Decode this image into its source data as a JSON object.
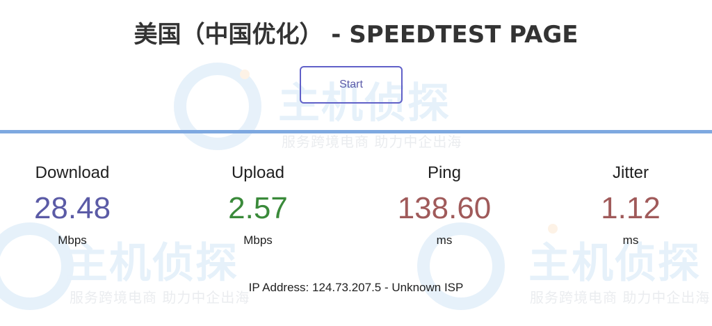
{
  "header": {
    "title": "美国（中国优化） - SPEEDTEST PAGE"
  },
  "controls": {
    "start_label": "Start"
  },
  "metrics": [
    {
      "label": "Download",
      "value": "28.48",
      "unit": "Mbps",
      "color": "#5b5ba6"
    },
    {
      "label": "Upload",
      "value": "2.57",
      "unit": "Mbps",
      "color": "#3a8a3a"
    },
    {
      "label": "Ping",
      "value": "138.60",
      "unit": "ms",
      "color": "#a05a5a"
    },
    {
      "label": "Jitter",
      "value": "1.12",
      "unit": "ms",
      "color": "#a05a5a"
    }
  ],
  "ip_info": "IP Address: 124.73.207.5 - Unknown ISP",
  "watermark": {
    "brand": "主机侦探",
    "slogan": "服务跨境电商 助力中企出海"
  },
  "colors": {
    "accent": "#6060c8",
    "progress": "#7ea8e0"
  }
}
